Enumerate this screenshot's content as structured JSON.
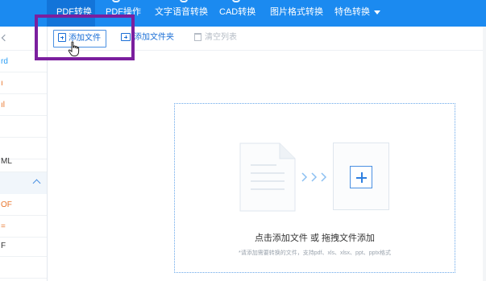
{
  "nav": {
    "items": [
      {
        "label": "PDF转换",
        "active": true
      },
      {
        "label": "PDF操作",
        "active": false
      },
      {
        "label": "文字语音转换",
        "active": false
      },
      {
        "label": "CAD转换",
        "active": false
      },
      {
        "label": "图片格式转换",
        "active": false
      },
      {
        "label": "特色转换",
        "active": false,
        "has_dropdown": true
      }
    ]
  },
  "toolbar": {
    "add_file_label": "添加文件",
    "add_folder_label": "添加文件夹",
    "clear_list_label": "清空列表"
  },
  "sidebar": {
    "rows": [
      {
        "label": "rd",
        "color": "#2a9df4"
      },
      {
        "label": "ı",
        "color": "#e8762d"
      },
      {
        "label": "ıl",
        "color": "#e8762d"
      },
      {
        "label": "",
        "color": "#333333"
      },
      {
        "label": "",
        "color": "#333333"
      },
      {
        "label": "ML",
        "color": "#333333"
      },
      {
        "label": "",
        "color": "#333333"
      },
      {
        "label": "OF",
        "color": "#e8762d"
      },
      {
        "label": "=",
        "color": "#e8762d"
      },
      {
        "label": "F",
        "color": "#333333"
      },
      {
        "label": "",
        "color": "#333333"
      }
    ]
  },
  "dropzone": {
    "title": "点击添加文件 或 拖拽文件添加",
    "hint": "*请添加需要转换的文件，支持pdf、xls、xlsx、ppt、pptx格式"
  },
  "colors": {
    "nav_bg": "#1b8af0",
    "accent": "#1b6fd6",
    "highlight": "#7b1f9e"
  }
}
